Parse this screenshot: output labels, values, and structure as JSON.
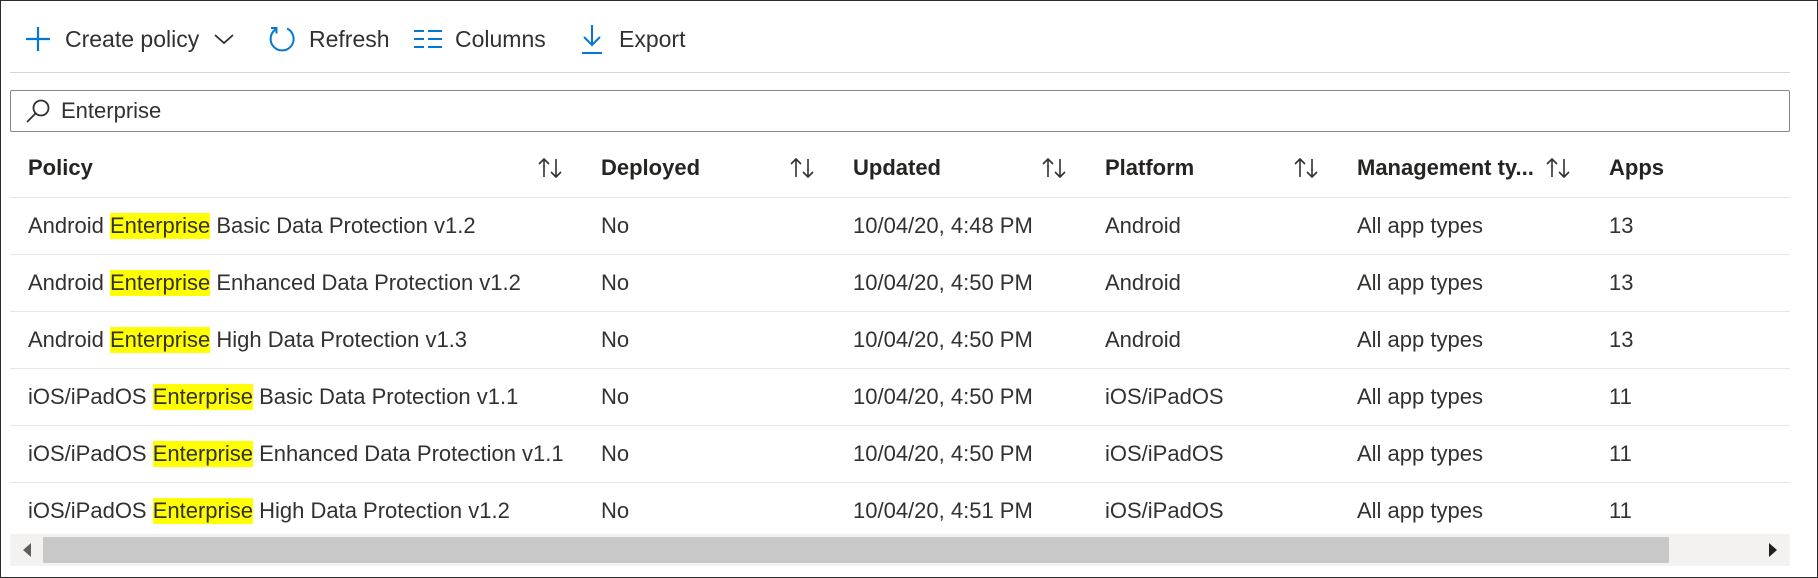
{
  "toolbar": {
    "create_label": "Create policy",
    "refresh_label": "Refresh",
    "columns_label": "Columns",
    "export_label": "Export"
  },
  "search": {
    "value": "Enterprise"
  },
  "table": {
    "headers": {
      "policy": "Policy",
      "deployed": "Deployed",
      "updated": "Updated",
      "platform": "Platform",
      "management": "Management ty...",
      "apps": "Apps"
    },
    "rows": [
      {
        "policy_pre": "Android ",
        "policy_hl": "Enterprise",
        "policy_post": " Basic Data Protection v1.2",
        "deployed": "No",
        "updated": "10/04/20, 4:48 PM",
        "platform": "Android",
        "management": "All app types",
        "apps": "13"
      },
      {
        "policy_pre": "Android ",
        "policy_hl": "Enterprise",
        "policy_post": " Enhanced Data Protection v1.2",
        "deployed": "No",
        "updated": "10/04/20, 4:50 PM",
        "platform": "Android",
        "management": "All app types",
        "apps": "13"
      },
      {
        "policy_pre": "Android ",
        "policy_hl": "Enterprise",
        "policy_post": " High Data Protection v1.3",
        "deployed": "No",
        "updated": "10/04/20, 4:50 PM",
        "platform": "Android",
        "management": "All app types",
        "apps": "13"
      },
      {
        "policy_pre": "iOS/iPadOS ",
        "policy_hl": "Enterprise",
        "policy_post": " Basic Data Protection v1.1",
        "deployed": "No",
        "updated": "10/04/20, 4:50 PM",
        "platform": "iOS/iPadOS",
        "management": "All app types",
        "apps": "11"
      },
      {
        "policy_pre": "iOS/iPadOS ",
        "policy_hl": "Enterprise",
        "policy_post": " Enhanced Data Protection v1.1",
        "deployed": "No",
        "updated": "10/04/20, 4:50 PM",
        "platform": "iOS/iPadOS",
        "management": "All app types",
        "apps": "11"
      },
      {
        "policy_pre": "iOS/iPadOS ",
        "policy_hl": "Enterprise",
        "policy_post": " High Data Protection v1.2",
        "deployed": "No",
        "updated": "10/04/20, 4:51 PM",
        "platform": "iOS/iPadOS",
        "management": "All app types",
        "apps": "11"
      }
    ]
  },
  "colors": {
    "accent": "#0078d4",
    "highlight": "#ffff00",
    "text": "#323130"
  },
  "icons": {
    "create": "plus-icon",
    "create_menu": "chevron-down-icon",
    "refresh": "refresh-icon",
    "columns": "columns-icon",
    "export": "download-icon",
    "search": "search-icon",
    "sort": "sort-icon"
  }
}
